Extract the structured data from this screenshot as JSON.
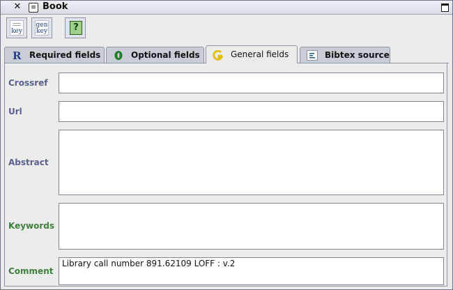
{
  "window": {
    "title": "Book"
  },
  "toolbar": {
    "key_label": "key",
    "genkey_label_top": "gen",
    "genkey_label_bottom": "key",
    "help_glyph": "?"
  },
  "tabs": [
    {
      "label": "Required fields",
      "icon": "required-icon",
      "selected": false
    },
    {
      "label": "Optional fields",
      "icon": "optional-icon",
      "selected": false
    },
    {
      "label": "General fields",
      "icon": "general-icon",
      "selected": true
    },
    {
      "label": "Bibtex source",
      "icon": "bibtex-source-icon",
      "selected": false
    }
  ],
  "fields": {
    "crossref": {
      "label": "Crossref",
      "value": ""
    },
    "url": {
      "label": "Url",
      "value": ""
    },
    "abstract": {
      "label": "Abstract",
      "value": ""
    },
    "keywords": {
      "label": "Keywords",
      "value": ""
    },
    "comment": {
      "label": "Comment",
      "value": "Library call number 891.62109 LOFF : v.2"
    }
  },
  "colors": {
    "label_blue": "#5a5f8e",
    "label_green": "#3f7f3f",
    "required_icon": "#2b3f8a",
    "optional_icon": "#1f7a2a",
    "general_icon": "#e0c21a"
  }
}
